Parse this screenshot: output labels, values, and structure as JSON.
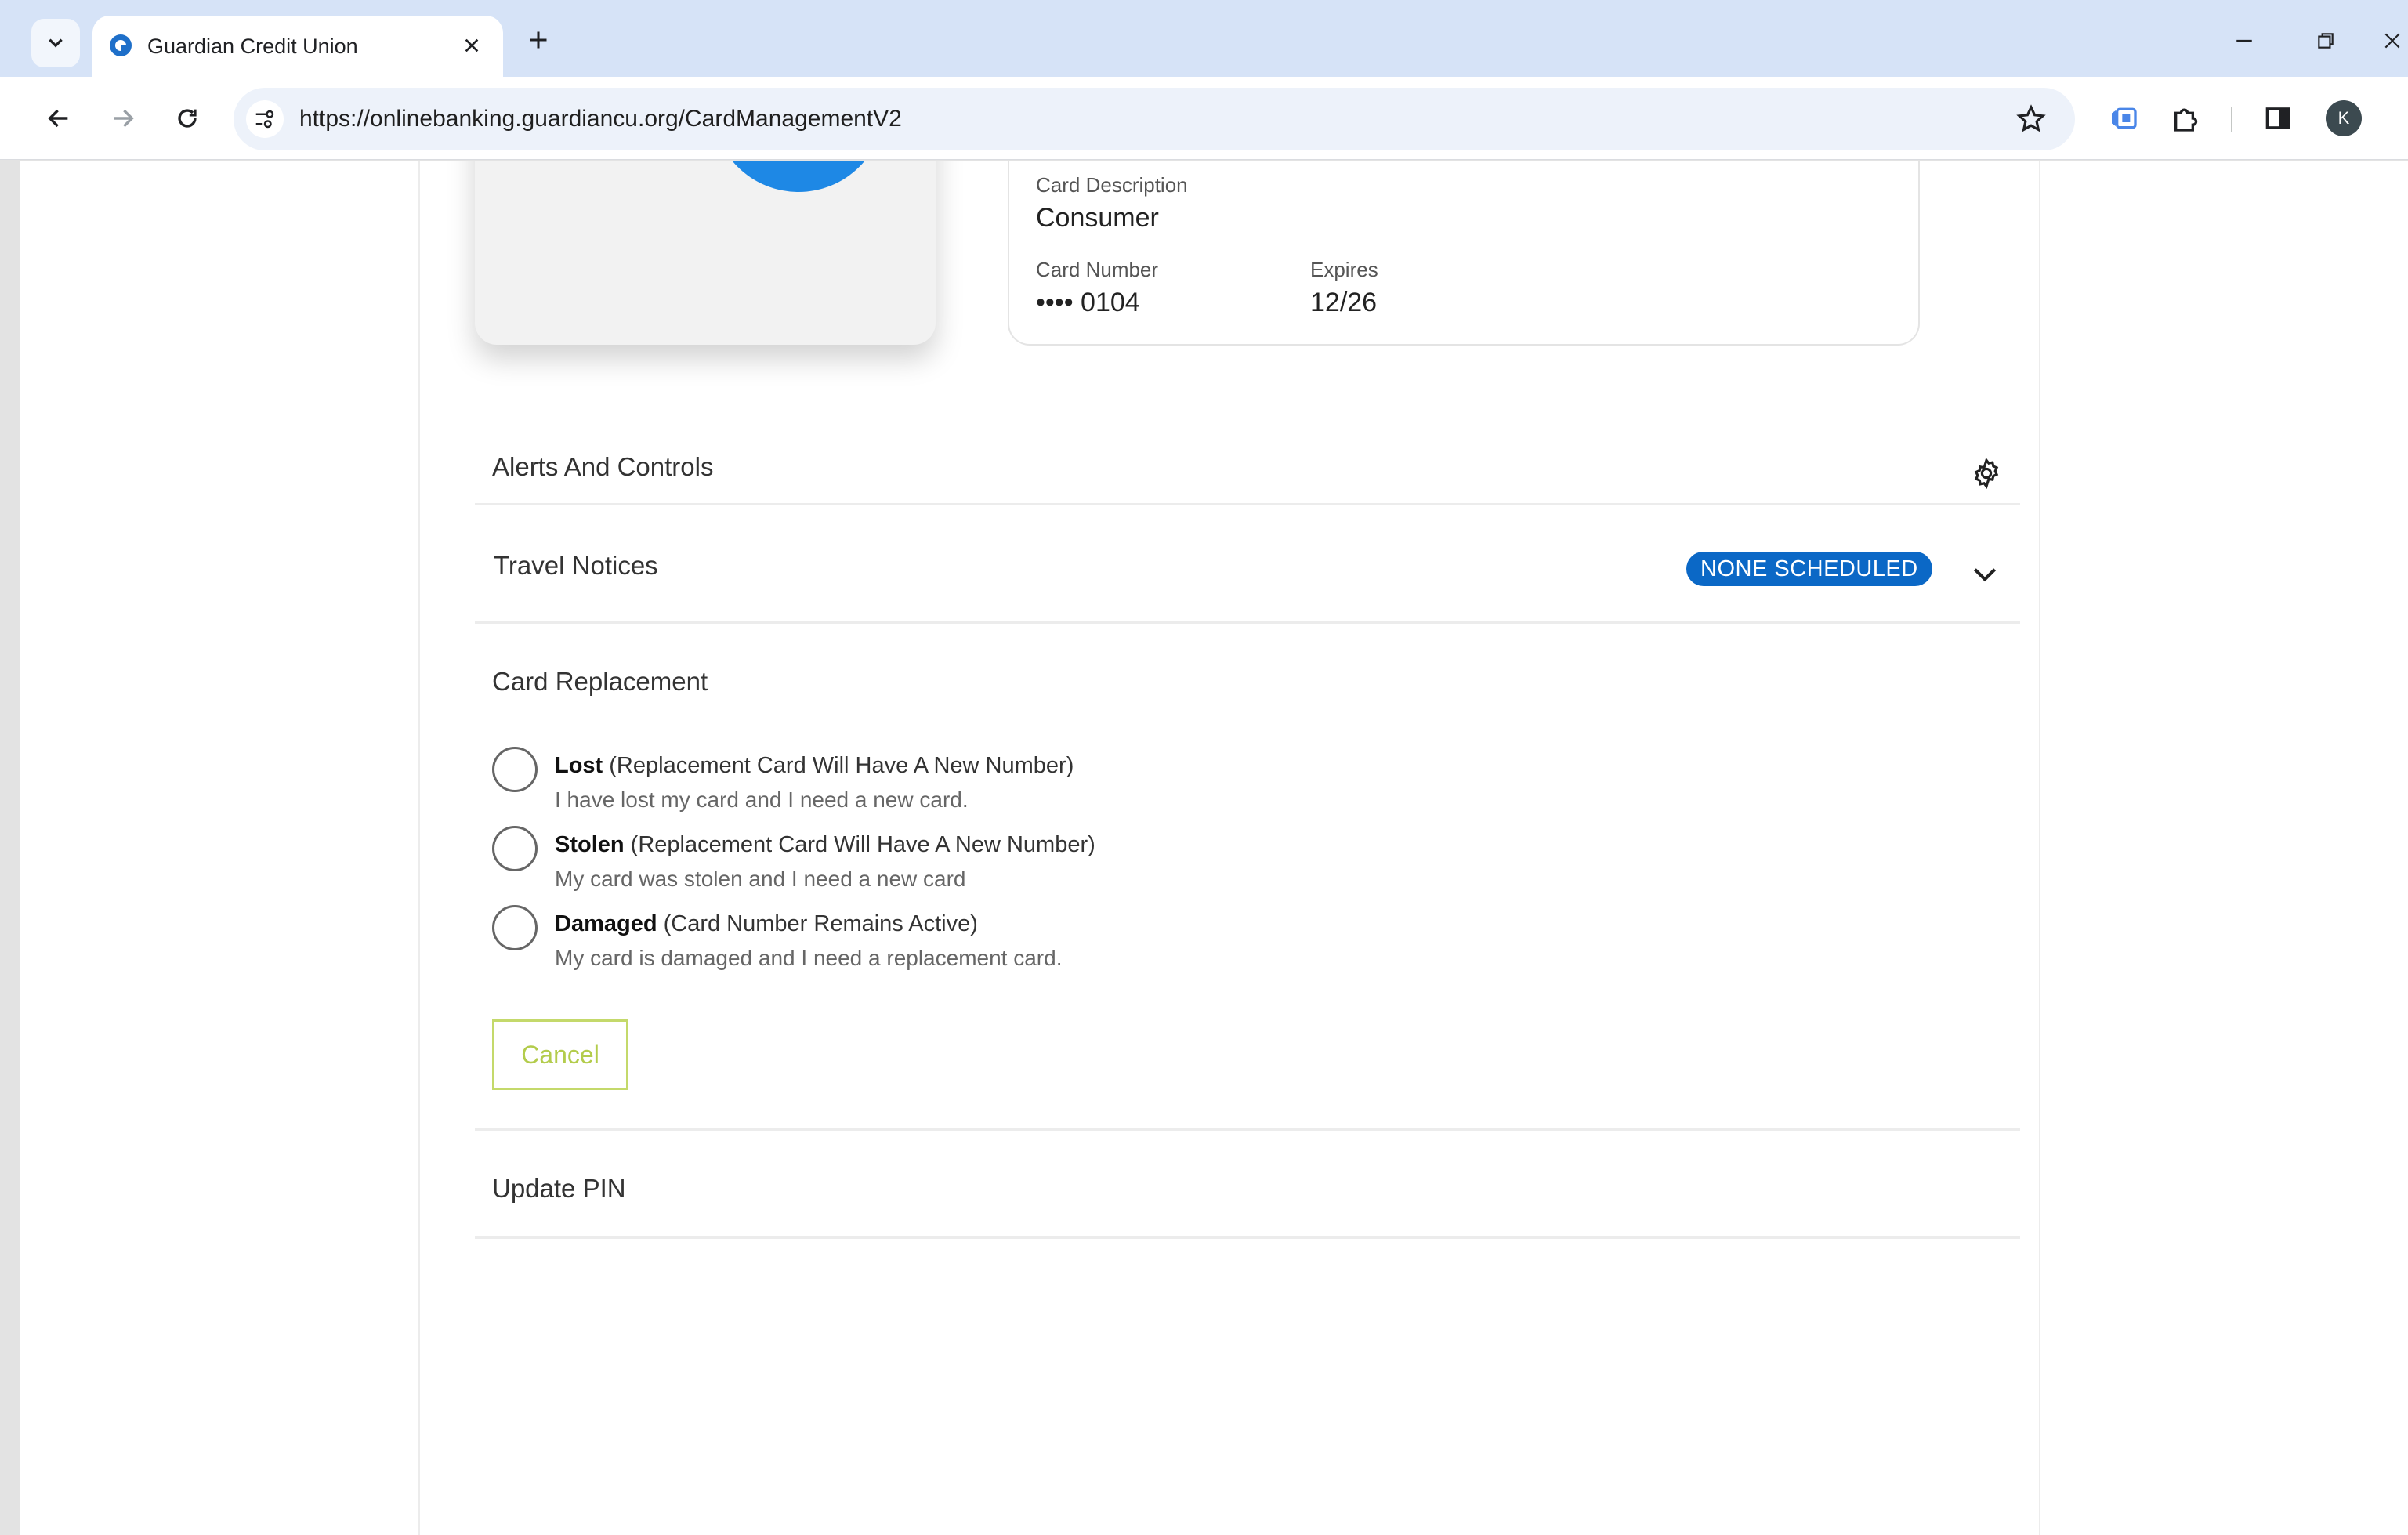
{
  "browser": {
    "tab_title": "Guardian Credit Union",
    "url": "https://onlinebanking.guardiancu.org/CardManagementV2",
    "profile_initial": "K"
  },
  "card": {
    "description_label": "Card Description",
    "description_value": "Consumer",
    "number_label": "Card Number",
    "number_value": "•••• 0104",
    "expires_label": "Expires",
    "expires_value": "12/26"
  },
  "sections": {
    "alerts_title": "Alerts And Controls",
    "travel_title": "Travel Notices",
    "travel_badge": "NONE  SCHEDULED",
    "replacement_title": "Card Replacement",
    "update_pin_title": "Update PIN"
  },
  "replacement_options": [
    {
      "bold": "Lost",
      "note": " (Replacement Card Will Have A New Number)",
      "description": "I have lost my card and I need a new card."
    },
    {
      "bold": "Stolen",
      "note": " (Replacement Card Will Have A New Number)",
      "description": "My card was stolen and I need a new card"
    },
    {
      "bold": "Damaged",
      "note": " (Card Number Remains Active)",
      "description": "My card is damaged and I need a replacement card."
    }
  ],
  "buttons": {
    "cancel_label": "Cancel"
  },
  "colors": {
    "badge_bg": "#0b68c6",
    "cancel_border": "#c4d96b",
    "seal_blue": "#1e88e5"
  },
  "icons": {
    "gear": "gear-icon",
    "chevron": "chevron-down-icon",
    "star": "star-icon",
    "extensions": "puzzle-icon"
  }
}
